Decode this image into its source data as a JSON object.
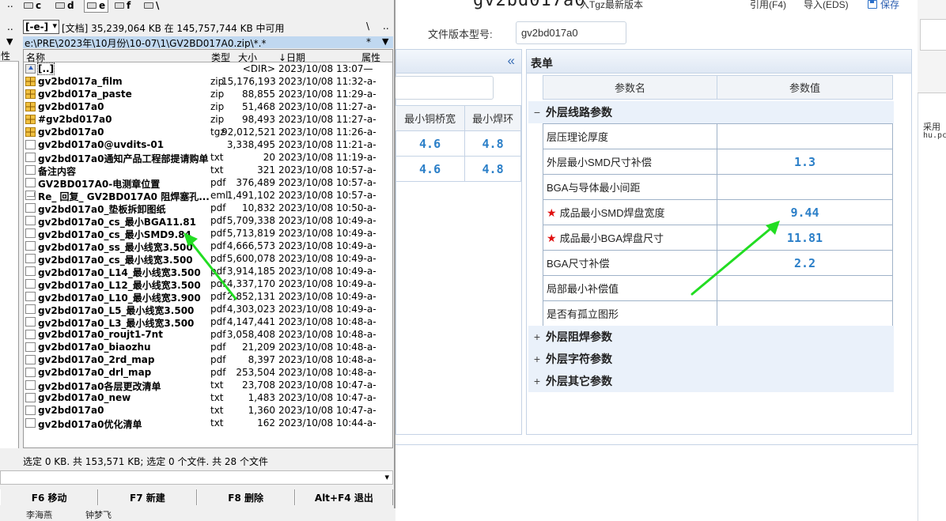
{
  "app": {
    "title": "gv2bd017a0",
    "import_tgz": "入Tgz最新版本",
    "ref": "引用(F4)",
    "import_eds": "导入(EDS)",
    "save": "保存",
    "version_label": "文件版本型号:",
    "version_value": "gv2bd017a0",
    "collapse_glyph": "«",
    "min_headers": [
      "最小铜桥宽",
      "最小焊环"
    ],
    "min_rows": [
      [
        "4.6",
        "4.8"
      ],
      [
        "4.6",
        "4.8"
      ]
    ],
    "form_title": "表单",
    "grid_headers": {
      "name": "参数名",
      "value": "参数值"
    },
    "groups": [
      {
        "toggle": "−",
        "label": "外层线路参数"
      },
      {
        "toggle": "+",
        "label": "外层阻焊参数"
      },
      {
        "toggle": "+",
        "label": "外层字符参数"
      },
      {
        "toggle": "+",
        "label": "外层其它参数"
      }
    ],
    "params": [
      {
        "name": "层压理论厚度",
        "value": "",
        "star": false
      },
      {
        "name": "外层最小SMD尺寸补偿",
        "value": "1.3",
        "star": false
      },
      {
        "name": "BGA与导体最小间距",
        "value": "",
        "star": false
      },
      {
        "name": "成品最小SMD焊盘宽度",
        "value": "9.44",
        "star": true
      },
      {
        "name": "成品最小BGA焊盘尺寸",
        "value": "11.81",
        "star": true
      },
      {
        "name": "BGA尺寸补偿",
        "value": "2.2",
        "star": false
      },
      {
        "name": "局部最小补偿值",
        "value": "",
        "star": false
      },
      {
        "name": "是否有孤立图形",
        "value": "",
        "star": false
      }
    ],
    "right_text1": "采用",
    "right_text2": "hu.pc"
  },
  "tc": {
    "drives": [
      {
        "icon": "drive-icon",
        "label": "c",
        "active": false
      },
      {
        "icon": "drive-icon",
        "label": "d",
        "active": false
      },
      {
        "icon": "drive-icon",
        "label": "e",
        "active": true
      },
      {
        "icon": "drive-icon",
        "label": "f",
        "active": false
      },
      {
        "icon": "network-icon",
        "label": "\\",
        "active": false
      }
    ],
    "left_dots": "..",
    "drive_select": "[-e-]",
    "free_space": "[文档]  35,239,064 KB 在 145,757,744 KB 中可用",
    "backslash": "\\",
    "dotdot": "..",
    "current_path": "e:\\PRE\\2023年\\10月份\\10-07\\1\\GV2BD017A0.zip\\*.*",
    "path_filter": "*",
    "left_head": "性",
    "columns": {
      "name": "名称",
      "type": "类型",
      "size": "大小",
      "date": "↓日期",
      "attr": "属性"
    },
    "files": [
      {
        "icon": "up",
        "name": "[..]",
        "ext": "",
        "size": "<DIR>",
        "date": "2023/10/08 13:07—"
      },
      {
        "icon": "zip",
        "name": "gv2bd017a_film",
        "ext": "zip",
        "size": "15,176,193",
        "date": "2023/10/08 11:32-a-"
      },
      {
        "icon": "zip",
        "name": "gv2bd017a_paste",
        "ext": "zip",
        "size": "88,855",
        "date": "2023/10/08 11:29-a-"
      },
      {
        "icon": "zip",
        "name": "gv2bd017a0",
        "ext": "zip",
        "size": "51,468",
        "date": "2023/10/08 11:27-a-"
      },
      {
        "icon": "zip",
        "name": "#gv2bd017a0",
        "ext": "zip",
        "size": "98,493",
        "date": "2023/10/08 11:27-a-"
      },
      {
        "icon": "zip",
        "name": "gv2bd017a0",
        "ext": "tgz",
        "size": "92,012,521",
        "date": "2023/10/08 11:26-a-"
      },
      {
        "icon": "doc",
        "name": "gv2bd017a0@uvdits-01",
        "ext": "",
        "size": "3,338,495",
        "date": "2023/10/08 11:21-a-"
      },
      {
        "icon": "doc",
        "name": "gv2bd017a0通知产品工程部提请购单",
        "ext": "txt",
        "size": "20",
        "date": "2023/10/08 11:19-a-"
      },
      {
        "icon": "doc",
        "name": "备注内容",
        "ext": "txt",
        "size": "321",
        "date": "2023/10/08 10:57-a-"
      },
      {
        "icon": "doc",
        "name": "GV2BD017A0-电测章位置",
        "ext": "pdf",
        "size": "376,489",
        "date": "2023/10/08 10:57-a-"
      },
      {
        "icon": "mail",
        "name": "Re_ 回复_ GV2BD017A0 阻焊塞孔...",
        "ext": "eml",
        "size": "1,491,102",
        "date": "2023/10/08 10:57-a-"
      },
      {
        "icon": "doc",
        "name": "gv2bd017a0_垫板拆卸图纸",
        "ext": "pdf",
        "size": "10,832",
        "date": "2023/10/08 10:50-a-"
      },
      {
        "icon": "doc",
        "name": "gv2bd017a0_cs_最小BGA11.81",
        "ext": "pdf",
        "size": "5,709,338",
        "date": "2023/10/08 10:49-a-"
      },
      {
        "icon": "doc",
        "name": "gv2bd017a0_cs_最小SMD9.84",
        "ext": "pdf",
        "size": "5,713,819",
        "date": "2023/10/08 10:49-a-"
      },
      {
        "icon": "doc",
        "name": "gv2bd017a0_ss_最小线宽3.500",
        "ext": "pdf",
        "size": "4,666,573",
        "date": "2023/10/08 10:49-a-"
      },
      {
        "icon": "doc",
        "name": "gv2bd017a0_cs_最小线宽3.500",
        "ext": "pdf",
        "size": "5,600,078",
        "date": "2023/10/08 10:49-a-"
      },
      {
        "icon": "doc",
        "name": "gv2bd017a0_L14_最小线宽3.500",
        "ext": "pdf",
        "size": "3,914,185",
        "date": "2023/10/08 10:49-a-"
      },
      {
        "icon": "doc",
        "name": "gv2bd017a0_L12_最小线宽3.500",
        "ext": "pdf",
        "size": "4,337,170",
        "date": "2023/10/08 10:49-a-"
      },
      {
        "icon": "doc",
        "name": "gv2bd017a0_L10_最小线宽3.900",
        "ext": "pdf",
        "size": "2,852,131",
        "date": "2023/10/08 10:49-a-"
      },
      {
        "icon": "doc",
        "name": "gv2bd017a0_L5_最小线宽3.500",
        "ext": "pdf",
        "size": "4,303,023",
        "date": "2023/10/08 10:49-a-"
      },
      {
        "icon": "doc",
        "name": "gv2bd017a0_L3_最小线宽3.500",
        "ext": "pdf",
        "size": "4,147,441",
        "date": "2023/10/08 10:48-a-"
      },
      {
        "icon": "doc",
        "name": "gv2bd017a0_roujt1-7nt",
        "ext": "pdf",
        "size": "3,058,408",
        "date": "2023/10/08 10:48-a-"
      },
      {
        "icon": "doc",
        "name": "gv2bd017a0_biaozhu",
        "ext": "pdf",
        "size": "21,209",
        "date": "2023/10/08 10:48-a-"
      },
      {
        "icon": "doc",
        "name": "gv2bd017a0_2rd_map",
        "ext": "pdf",
        "size": "8,397",
        "date": "2023/10/08 10:48-a-"
      },
      {
        "icon": "doc",
        "name": "gv2bd017a0_drl_map",
        "ext": "pdf",
        "size": "253,504",
        "date": "2023/10/08 10:48-a-"
      },
      {
        "icon": "doc",
        "name": "gv2bd017a0各层更改清单",
        "ext": "txt",
        "size": "23,708",
        "date": "2023/10/08 10:47-a-"
      },
      {
        "icon": "doc",
        "name": "gv2bd017a0_new",
        "ext": "txt",
        "size": "1,483",
        "date": "2023/10/08 10:47-a-"
      },
      {
        "icon": "doc",
        "name": "gv2bd017a0",
        "ext": "txt",
        "size": "1,360",
        "date": "2023/10/08 10:47-a-"
      },
      {
        "icon": "doc",
        "name": "gv2bd017a0优化清单",
        "ext": "txt",
        "size": "162",
        "date": "2023/10/08 10:44-a-"
      }
    ],
    "status": "选定 0 KB. 共 153,571 KB; 选定 0 个文件. 共 28 个文件",
    "fkeys": [
      "F6 移动",
      "F7 新建",
      "F8 删除",
      "Alt+F4 退出"
    ],
    "bottom1": "李海燕",
    "bottom2": "钟梦飞"
  },
  "colors": {
    "highlight_arrow": "#22dd22",
    "value_blue": "#2b7fc8",
    "required_star": "#e01010",
    "path_bar": "#c0d8f0"
  }
}
